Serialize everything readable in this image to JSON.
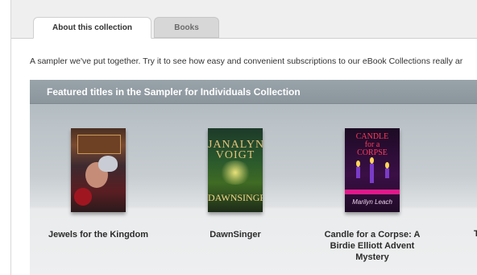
{
  "tabs": [
    {
      "label": "About this collection",
      "active": true
    },
    {
      "label": "Books",
      "active": false
    }
  ],
  "intro_text": "A sampler we've put together. Try it to see how easy and convenient subscriptions to our eBook Collections really ar",
  "panel": {
    "title": "Featured titles in the Sampler for Individuals Collection"
  },
  "books": [
    {
      "title": "Jewels for the Kingdom"
    },
    {
      "title": "DawnSinger",
      "cover_text": [
        "JANALYN",
        "VOIGT"
      ],
      "cover_author": "DAWNSINGER"
    },
    {
      "title": "Candle for a Corpse: A Birdie Elliott Advent Mystery",
      "cover_text": [
        "CANDLE",
        "for a",
        "CORPSE"
      ],
      "cover_author": "Marilyn Leach"
    }
  ],
  "partial_book_title_char": "T",
  "colors": {
    "panel_header": "#8f999f",
    "tab_active_bg": "#ffffff",
    "tab_inactive_bg": "#d7d7d7"
  }
}
